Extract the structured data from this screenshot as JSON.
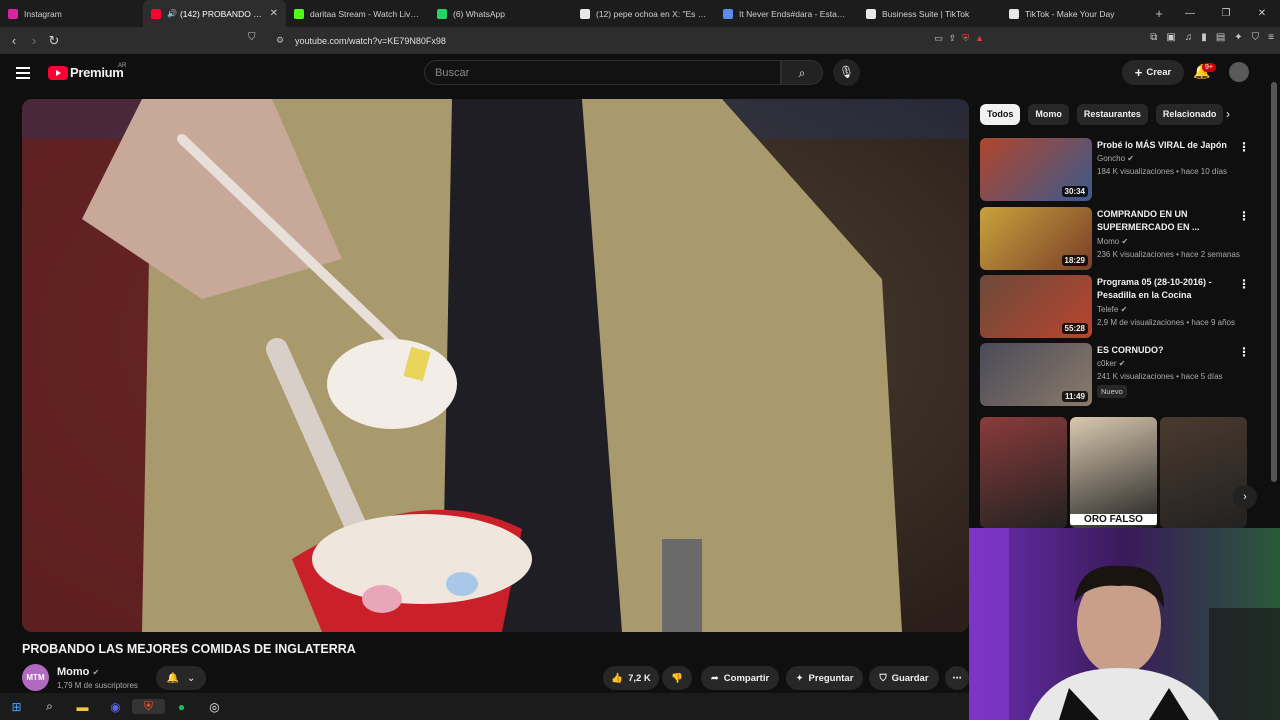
{
  "browser": {
    "tabs": [
      {
        "title": "Instagram",
        "color": "#d6249f",
        "active": false
      },
      {
        "title": "(142) PROBANDO LAS MEJORES COMIDAS",
        "color": "#ff0033",
        "active": true,
        "muted": true
      },
      {
        "title": "daritaa Stream - Watch Live on Kick",
        "color": "#53fc18",
        "active": false
      },
      {
        "title": "(6) WhatsApp",
        "color": "#25d366",
        "active": false
      },
      {
        "title": "(12) pepe ochoa en X: \"Es el mejor",
        "color": "#e7e7e7",
        "active": false
      },
      {
        "title": "It Never Ends#dara - Estadísticas",
        "color": "#5b8def",
        "active": false
      },
      {
        "title": "Business Suite | TikTok",
        "color": "#e7e7e7",
        "active": false
      },
      {
        "title": "TikTok - Make Your Day",
        "color": "#e7e7e7",
        "active": false
      }
    ],
    "new_tab": "+",
    "url": "youtube.com/watch?v=KE79N80Fx98"
  },
  "header": {
    "logo_text": "Premium",
    "region": "AR",
    "search_placeholder": "Buscar",
    "create_label": "Crear",
    "notifications_badge": "9+"
  },
  "video": {
    "title": "PROBANDO LAS MEJORES COMIDAS DE INGLATERRA",
    "channel": "Momo",
    "subscribers": "1,79 M de suscriptores",
    "channel_avatar_text": "MTM",
    "likes": "7,2 K",
    "share_label": "Compartir",
    "ask_label": "Preguntar",
    "save_label": "Guardar"
  },
  "chips": [
    "Todos",
    "Momo",
    "Restaurantes",
    "Relacionado"
  ],
  "recommendations": [
    {
      "title": "Probé lo MÁS VIRAL de Japón",
      "channel": "Goncho",
      "meta": "184 K visualizaciones • hace 10 días",
      "duration": "30:34",
      "colors": [
        "#b1452c",
        "#3b5a8c"
      ],
      "new": ""
    },
    {
      "title": "COMPRANDO EN UN SUPERMERCADO EN ...",
      "channel": "Momo",
      "meta": "236 K visualizaciones • hace 2 semanas",
      "duration": "18:29",
      "colors": [
        "#c9a23a",
        "#7a3e2a"
      ],
      "new": ""
    },
    {
      "title": "Programa 05 (28-10-2016) - Pesadilla en la Cocina",
      "channel": "Telefe",
      "meta": "2,9 M de visualizaciones • hace 9 años",
      "duration": "55:28",
      "colors": [
        "#6b4a3a",
        "#b9442e"
      ],
      "new": ""
    },
    {
      "title": "ES CORNUDO?",
      "channel": "c0ker",
      "meta": "241 K visualizaciones • hace 5 días",
      "duration": "11:49",
      "colors": [
        "#4a4a58",
        "#8a7a6a"
      ],
      "new": "Nuevo"
    }
  ],
  "shorts": [
    {
      "caption": "",
      "color": "#8a3b3b"
    },
    {
      "caption": "ORO FALSO",
      "color": "#d9c9b0"
    },
    {
      "caption": "",
      "color": "#4a3a2e"
    }
  ]
}
